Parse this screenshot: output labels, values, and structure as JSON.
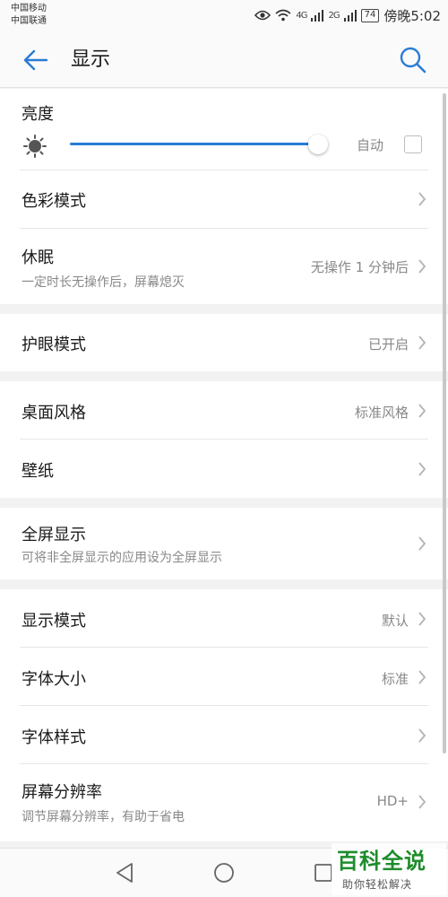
{
  "status_bar": {
    "carrier_1": "中国移动",
    "carrier_2": "中国联通",
    "net_1": "4G",
    "net_2": "2G",
    "battery": "74",
    "time": "傍晚5:02"
  },
  "app_bar": {
    "title": "显示"
  },
  "brightness": {
    "label": "亮度",
    "level": 0.95,
    "auto_label": "自动",
    "auto_checked": false
  },
  "rows": {
    "color_mode": {
      "label": "色彩模式"
    },
    "sleep": {
      "label": "休眠",
      "sub": "一定时长无操作后，屏幕熄灭",
      "value": "无操作 1 分钟后"
    },
    "eye_comfort": {
      "label": "护眼模式",
      "value": "已开启"
    },
    "home_style": {
      "label": "桌面风格",
      "value": "标准风格"
    },
    "wallpaper": {
      "label": "壁纸"
    },
    "full_screen": {
      "label": "全屏显示",
      "sub": "可将非全屏显示的应用设为全屏显示"
    },
    "display_mode": {
      "label": "显示模式",
      "value": "默认"
    },
    "font_size": {
      "label": "字体大小",
      "value": "标准"
    },
    "font_style": {
      "label": "字体样式"
    },
    "resolution": {
      "label": "屏幕分辨率",
      "sub": "调节屏幕分辨率，有助于省电",
      "value": "HD+"
    }
  },
  "watermark": {
    "title": "百科全说",
    "sub": "助你轻松解决"
  },
  "colors": {
    "accent": "#2a7bd6",
    "watermark_green": "#1e8c2c"
  }
}
